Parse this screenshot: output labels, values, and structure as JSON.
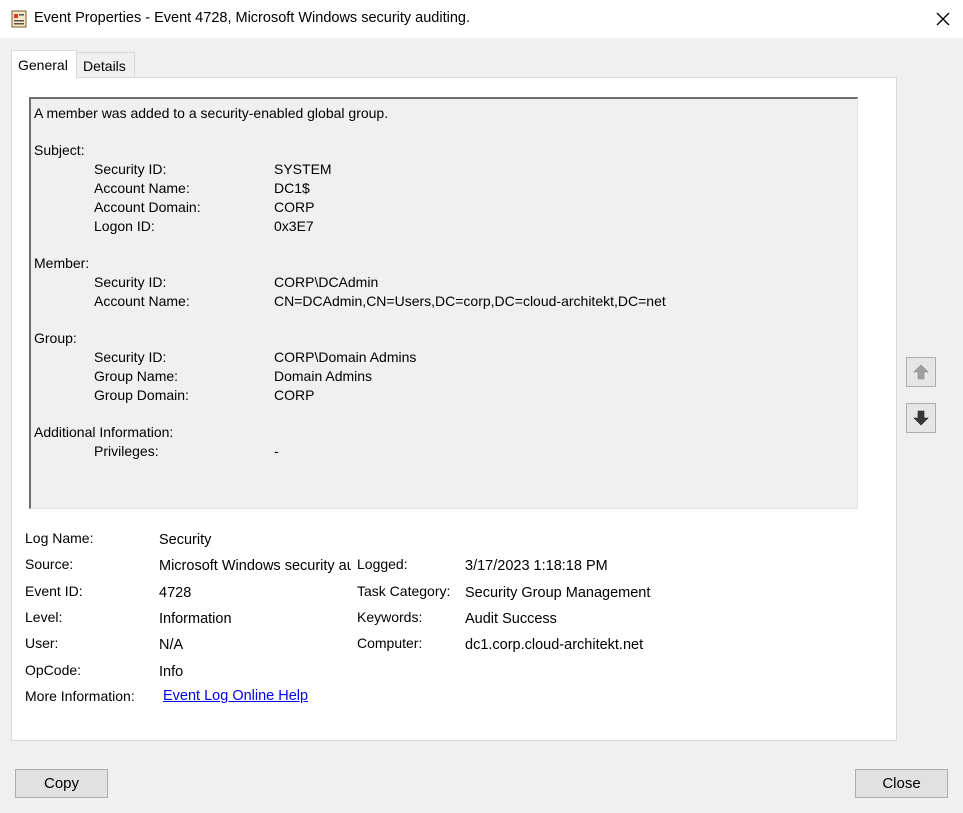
{
  "window": {
    "title": "Event Properties - Event 4728, Microsoft Windows security auditing.",
    "icon": "event-viewer-icon"
  },
  "tabs": [
    {
      "label": "General",
      "selected": true
    },
    {
      "label": "Details",
      "selected": false
    }
  ],
  "description": {
    "summary": "A member was added to a security-enabled global group.",
    "subject": {
      "heading": "Subject:",
      "fields": [
        {
          "label": "Security ID:",
          "value": "SYSTEM"
        },
        {
          "label": "Account Name:",
          "value": "DC1$"
        },
        {
          "label": "Account Domain:",
          "value": "CORP"
        },
        {
          "label": "Logon ID:",
          "value": "0x3E7"
        }
      ]
    },
    "member": {
      "heading": "Member:",
      "fields": [
        {
          "label": "Security ID:",
          "value": "CORP\\DCAdmin"
        },
        {
          "label": "Account Name:",
          "value": "CN=DCAdmin,CN=Users,DC=corp,DC=cloud-architekt,DC=net"
        }
      ]
    },
    "group": {
      "heading": "Group:",
      "fields": [
        {
          "label": "Security ID:",
          "value": "CORP\\Domain Admins"
        },
        {
          "label": "Group Name:",
          "value": "Domain Admins"
        },
        {
          "label": "Group Domain:",
          "value": "CORP"
        }
      ]
    },
    "additional": {
      "heading": "Additional Information:",
      "fields": [
        {
          "label": "Privileges:",
          "value": "-"
        }
      ]
    }
  },
  "meta": {
    "log_name": {
      "label": "Log Name:",
      "value": "Security"
    },
    "source": {
      "label": "Source:",
      "value": "Microsoft Windows security auditing."
    },
    "event_id": {
      "label": "Event ID:",
      "value": "4728"
    },
    "level": {
      "label": "Level:",
      "value": "Information"
    },
    "user": {
      "label": "User:",
      "value": "N/A"
    },
    "opcode": {
      "label": "OpCode:",
      "value": "Info"
    },
    "more_info": {
      "label": "More Information:",
      "link": "Event Log Online Help"
    },
    "logged": {
      "label": "Logged:",
      "value": "3/17/2023 1:18:18 PM"
    },
    "task_category": {
      "label": "Task Category:",
      "value": "Security Group Management"
    },
    "keywords": {
      "label": "Keywords:",
      "value": "Audit Success"
    },
    "computer": {
      "label": "Computer:",
      "value": "dc1.corp.cloud-architekt.net"
    }
  },
  "buttons": {
    "copy": "Copy",
    "close": "Close"
  },
  "colors": {
    "link": "#0000ee",
    "panel_bg": "#ffffff",
    "dialog_bg": "#f0f0f0"
  }
}
